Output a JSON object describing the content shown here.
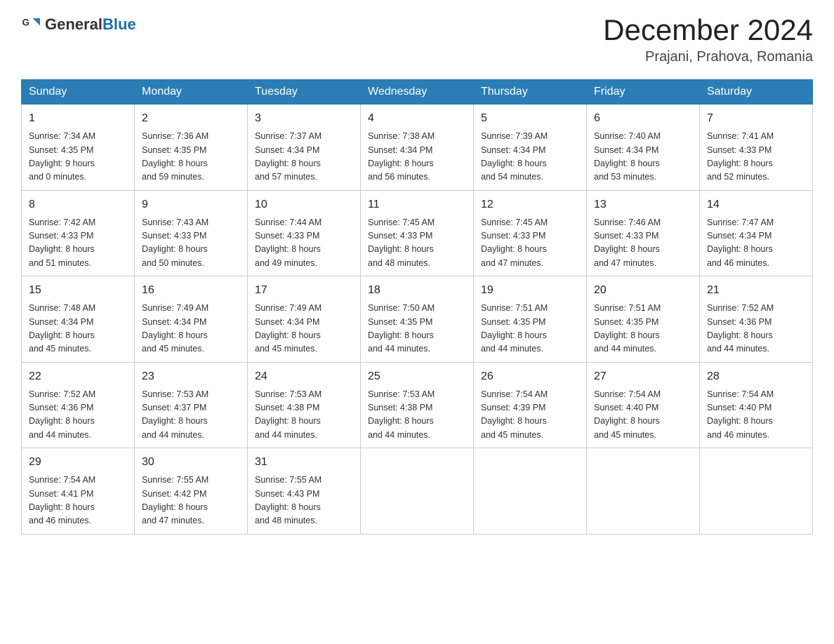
{
  "logo": {
    "general": "General",
    "blue": "Blue"
  },
  "title": "December 2024",
  "location": "Prajani, Prahova, Romania",
  "days_of_week": [
    "Sunday",
    "Monday",
    "Tuesday",
    "Wednesday",
    "Thursday",
    "Friday",
    "Saturday"
  ],
  "weeks": [
    [
      {
        "day": "1",
        "sunrise": "7:34 AM",
        "sunset": "4:35 PM",
        "daylight": "9 hours and 0 minutes."
      },
      {
        "day": "2",
        "sunrise": "7:36 AM",
        "sunset": "4:35 PM",
        "daylight": "8 hours and 59 minutes."
      },
      {
        "day": "3",
        "sunrise": "7:37 AM",
        "sunset": "4:34 PM",
        "daylight": "8 hours and 57 minutes."
      },
      {
        "day": "4",
        "sunrise": "7:38 AM",
        "sunset": "4:34 PM",
        "daylight": "8 hours and 56 minutes."
      },
      {
        "day": "5",
        "sunrise": "7:39 AM",
        "sunset": "4:34 PM",
        "daylight": "8 hours and 54 minutes."
      },
      {
        "day": "6",
        "sunrise": "7:40 AM",
        "sunset": "4:34 PM",
        "daylight": "8 hours and 53 minutes."
      },
      {
        "day": "7",
        "sunrise": "7:41 AM",
        "sunset": "4:33 PM",
        "daylight": "8 hours and 52 minutes."
      }
    ],
    [
      {
        "day": "8",
        "sunrise": "7:42 AM",
        "sunset": "4:33 PM",
        "daylight": "8 hours and 51 minutes."
      },
      {
        "day": "9",
        "sunrise": "7:43 AM",
        "sunset": "4:33 PM",
        "daylight": "8 hours and 50 minutes."
      },
      {
        "day": "10",
        "sunrise": "7:44 AM",
        "sunset": "4:33 PM",
        "daylight": "8 hours and 49 minutes."
      },
      {
        "day": "11",
        "sunrise": "7:45 AM",
        "sunset": "4:33 PM",
        "daylight": "8 hours and 48 minutes."
      },
      {
        "day": "12",
        "sunrise": "7:45 AM",
        "sunset": "4:33 PM",
        "daylight": "8 hours and 47 minutes."
      },
      {
        "day": "13",
        "sunrise": "7:46 AM",
        "sunset": "4:33 PM",
        "daylight": "8 hours and 47 minutes."
      },
      {
        "day": "14",
        "sunrise": "7:47 AM",
        "sunset": "4:34 PM",
        "daylight": "8 hours and 46 minutes."
      }
    ],
    [
      {
        "day": "15",
        "sunrise": "7:48 AM",
        "sunset": "4:34 PM",
        "daylight": "8 hours and 45 minutes."
      },
      {
        "day": "16",
        "sunrise": "7:49 AM",
        "sunset": "4:34 PM",
        "daylight": "8 hours and 45 minutes."
      },
      {
        "day": "17",
        "sunrise": "7:49 AM",
        "sunset": "4:34 PM",
        "daylight": "8 hours and 45 minutes."
      },
      {
        "day": "18",
        "sunrise": "7:50 AM",
        "sunset": "4:35 PM",
        "daylight": "8 hours and 44 minutes."
      },
      {
        "day": "19",
        "sunrise": "7:51 AM",
        "sunset": "4:35 PM",
        "daylight": "8 hours and 44 minutes."
      },
      {
        "day": "20",
        "sunrise": "7:51 AM",
        "sunset": "4:35 PM",
        "daylight": "8 hours and 44 minutes."
      },
      {
        "day": "21",
        "sunrise": "7:52 AM",
        "sunset": "4:36 PM",
        "daylight": "8 hours and 44 minutes."
      }
    ],
    [
      {
        "day": "22",
        "sunrise": "7:52 AM",
        "sunset": "4:36 PM",
        "daylight": "8 hours and 44 minutes."
      },
      {
        "day": "23",
        "sunrise": "7:53 AM",
        "sunset": "4:37 PM",
        "daylight": "8 hours and 44 minutes."
      },
      {
        "day": "24",
        "sunrise": "7:53 AM",
        "sunset": "4:38 PM",
        "daylight": "8 hours and 44 minutes."
      },
      {
        "day": "25",
        "sunrise": "7:53 AM",
        "sunset": "4:38 PM",
        "daylight": "8 hours and 44 minutes."
      },
      {
        "day": "26",
        "sunrise": "7:54 AM",
        "sunset": "4:39 PM",
        "daylight": "8 hours and 45 minutes."
      },
      {
        "day": "27",
        "sunrise": "7:54 AM",
        "sunset": "4:40 PM",
        "daylight": "8 hours and 45 minutes."
      },
      {
        "day": "28",
        "sunrise": "7:54 AM",
        "sunset": "4:40 PM",
        "daylight": "8 hours and 46 minutes."
      }
    ],
    [
      {
        "day": "29",
        "sunrise": "7:54 AM",
        "sunset": "4:41 PM",
        "daylight": "8 hours and 46 minutes."
      },
      {
        "day": "30",
        "sunrise": "7:55 AM",
        "sunset": "4:42 PM",
        "daylight": "8 hours and 47 minutes."
      },
      {
        "day": "31",
        "sunrise": "7:55 AM",
        "sunset": "4:43 PM",
        "daylight": "8 hours and 48 minutes."
      },
      null,
      null,
      null,
      null
    ]
  ]
}
